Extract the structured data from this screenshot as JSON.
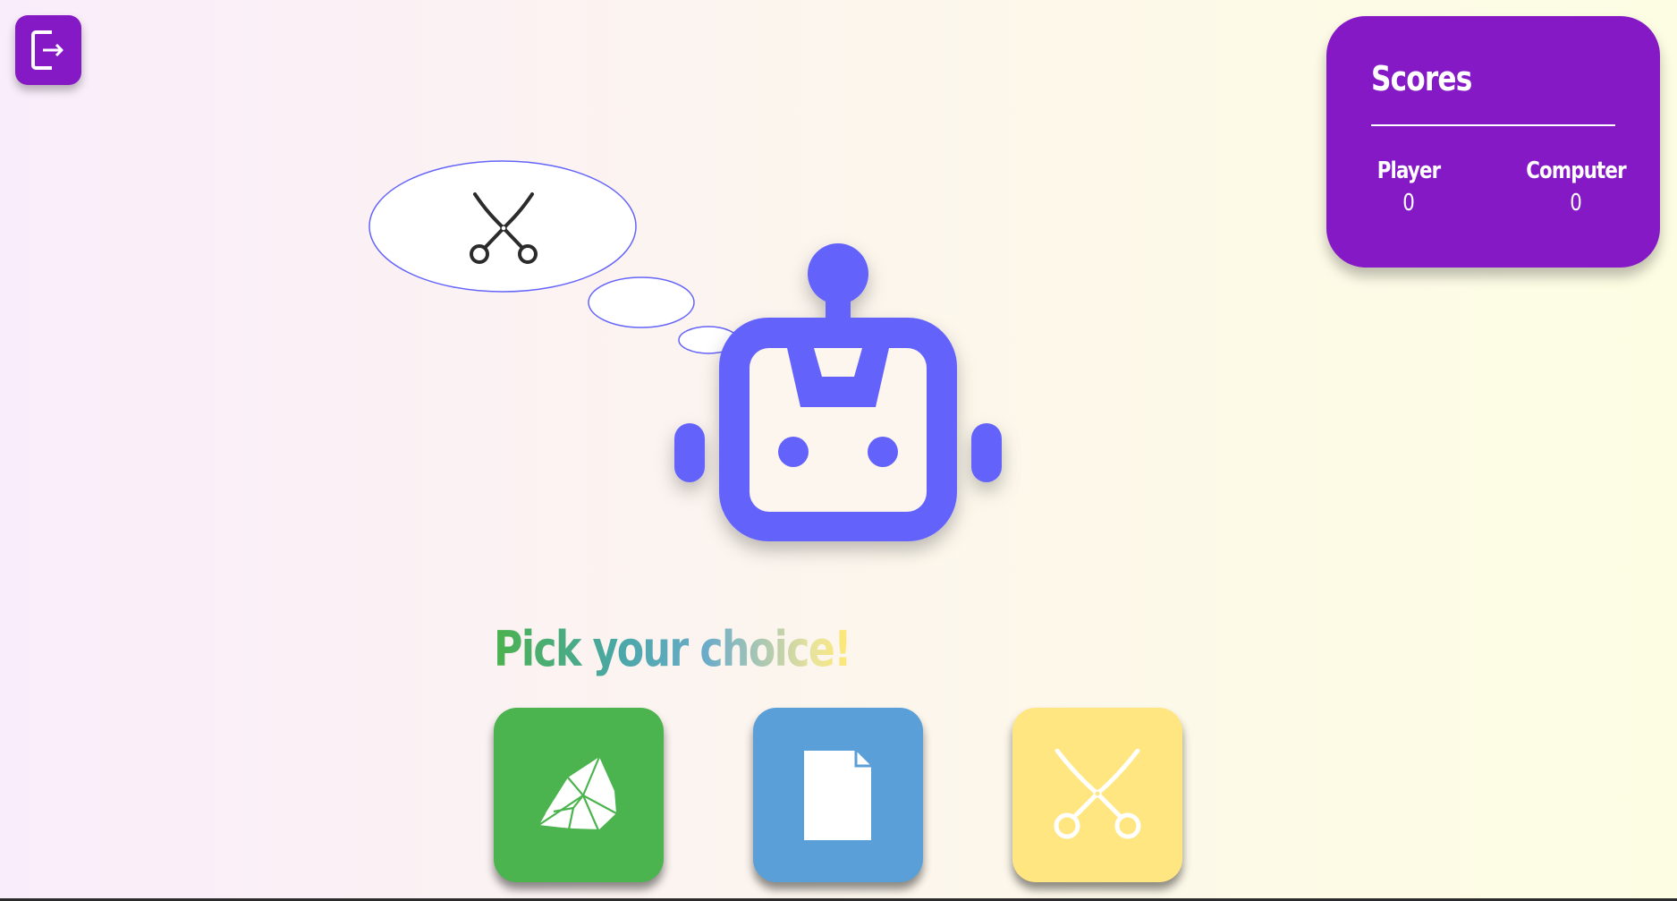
{
  "header": {
    "exit_icon": "logout-icon"
  },
  "scores": {
    "title": "Scores",
    "player_label": "Player",
    "player_value": "0",
    "computer_label": "Computer",
    "computer_value": "0"
  },
  "computer": {
    "avatar_icon": "robot-icon",
    "thinking_choice": "scissors",
    "thinking_icon": "scissors-icon"
  },
  "prompt": {
    "text": "Pick your choice!"
  },
  "choices": [
    {
      "id": "rock",
      "icon": "rock-icon",
      "color": "#4bb44e"
    },
    {
      "id": "paper",
      "icon": "paper-icon",
      "color": "#5b9fd8"
    },
    {
      "id": "scissors",
      "icon": "scissors-icon",
      "color": "#ffe680"
    }
  ],
  "colors": {
    "accent": "#8619c6",
    "robot": "#6464fb",
    "bubble_border": "#6464fb"
  }
}
